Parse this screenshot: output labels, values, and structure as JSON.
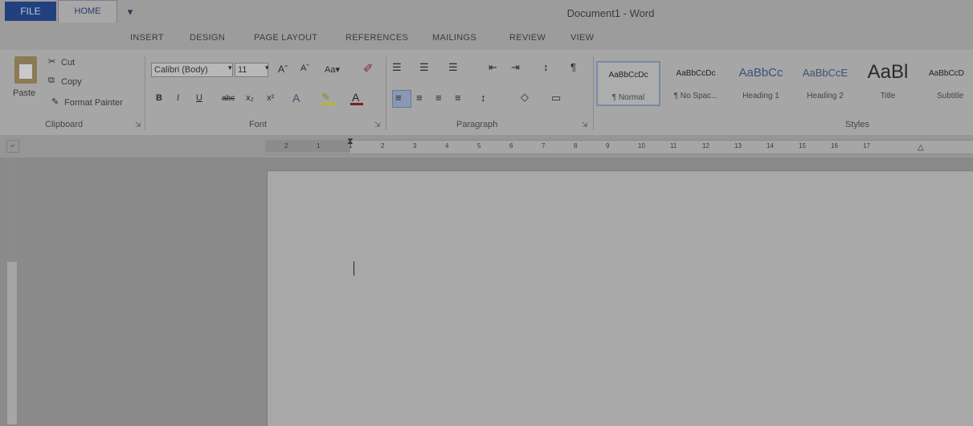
{
  "window": {
    "title": "Document1 - Word"
  },
  "qat": {
    "save_glyph": "▤",
    "undo_glyph": "↶",
    "redo_glyph": "↻",
    "customize_glyph": "▾",
    "word_glyph": "▣"
  },
  "tabs": {
    "file": "FILE",
    "home": "HOME",
    "insert": "INSERT",
    "design": "DESIGN",
    "page_layout": "PAGE LAYOUT",
    "references": "REFERENCES",
    "mailings": "MAILINGS",
    "review": "REVIEW",
    "view": "VIEW"
  },
  "clipboard": {
    "paste": "Paste",
    "cut": "Cut",
    "copy": "Copy",
    "format_painter": "Format Painter",
    "label": "Clipboard"
  },
  "font": {
    "name": "Calibri (Body)",
    "size": "11",
    "label": "Font",
    "grow": "Aˆ",
    "shrink": "Aˇ",
    "change_case": "Aa▾",
    "bold": "B",
    "italic": "I",
    "underline": "U",
    "strike": "abc",
    "subscript": "x₂",
    "superscript": "x²"
  },
  "paragraph": {
    "label": "Paragraph",
    "show_marks": "¶",
    "sort": "↕"
  },
  "styles": {
    "label": "Styles",
    "items": [
      {
        "sample": "AaBbCcDc",
        "name": "¶ Normal"
      },
      {
        "sample": "AaBbCcDc",
        "name": "¶ No Spac..."
      },
      {
        "sample": "AaBbCc",
        "name": "Heading 1"
      },
      {
        "sample": "AaBbCcE",
        "name": "Heading 2"
      },
      {
        "sample": "AaBl",
        "name": "Title"
      },
      {
        "sample": "AaBbCcD",
        "name": "Subtitle"
      }
    ]
  },
  "ruler": {
    "numbers": [
      "2",
      "1",
      "1",
      "2",
      "3",
      "4",
      "5",
      "6",
      "7",
      "8",
      "9",
      "10",
      "11",
      "12",
      "13",
      "14",
      "15",
      "16",
      "17"
    ]
  },
  "colors": {
    "file_tab": "#23407e",
    "accent_text": "#2a3c6e"
  }
}
